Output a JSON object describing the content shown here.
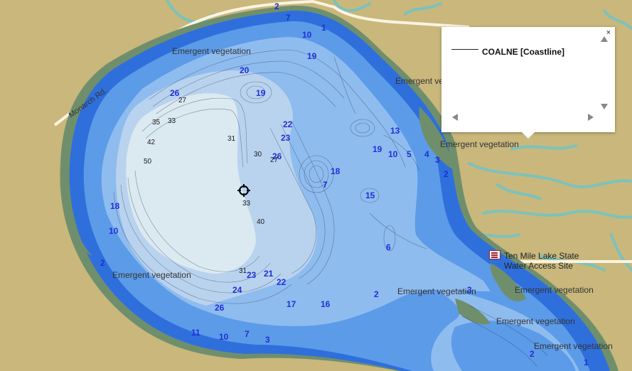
{
  "road_label": "Monarch Rd.",
  "vegetation_label": "Emergent vegetation",
  "access": {
    "line1": "Ten Mile Lake State",
    "line2": "Water Access Site"
  },
  "popup": {
    "close_glyph": "×",
    "legend_label": "COALNE [Coastline]"
  },
  "depths": {
    "blue": [
      "2",
      "7",
      "10",
      "1",
      "19",
      "20",
      "19",
      "26",
      "22",
      "23",
      "26",
      "18",
      "7",
      "15",
      "13",
      "19",
      "10",
      "5",
      "4",
      "3",
      "2",
      "18",
      "10",
      "2",
      "23",
      "21",
      "22",
      "24",
      "26",
      "17",
      "16",
      "6",
      "2",
      "11",
      "10",
      "7",
      "3",
      "2",
      "1",
      "3"
    ],
    "black": [
      "27",
      "35",
      "33",
      "42",
      "50",
      "31",
      "30",
      "27",
      "33",
      "40",
      "31"
    ]
  },
  "colors": {
    "land": "#c9b77c",
    "water_shallow": "#2f6fdc",
    "water_mid": "#5c9be8",
    "water_deep": "#8fbcef",
    "water_deepest": "#dbe9f1",
    "wetland": "#6f8f6c",
    "depth_label": "#1f2fd6"
  },
  "icons": {
    "locator": "crosshair-icon",
    "access": "boat-ramp-icon"
  }
}
